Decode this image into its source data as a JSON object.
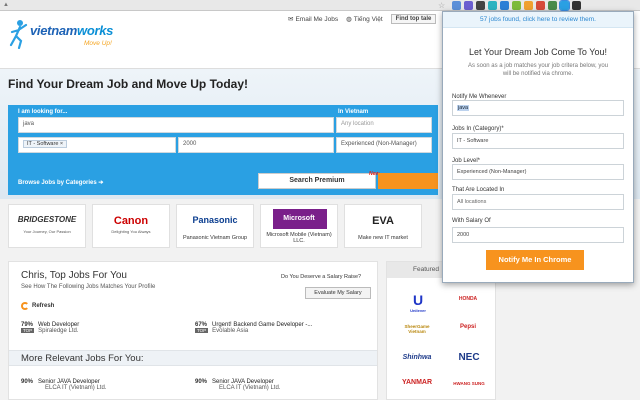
{
  "browser": {
    "extensions": [
      {
        "icon": "folder-icon",
        "color": "#5b8fd8"
      },
      {
        "icon": "extension-icon-2",
        "color": "#6b5ed0"
      },
      {
        "icon": "extension-icon-3",
        "color": "#444444"
      },
      {
        "icon": "extension-icon-4",
        "color": "#2bb3c0"
      },
      {
        "icon": "extension-icon-5",
        "color": "#2d7fd6"
      },
      {
        "icon": "extension-icon-6",
        "color": "#7dbb3a"
      },
      {
        "icon": "extension-icon-7",
        "color": "#f0a030"
      },
      {
        "icon": "extension-icon-8",
        "color": "#d64a3a"
      },
      {
        "icon": "extension-icon-9",
        "color": "#4a8a4a"
      },
      {
        "icon": "vietnamworks-extension-icon",
        "color": "#2aa0e3"
      },
      {
        "icon": "github-icon",
        "color": "#333333"
      }
    ]
  },
  "header": {
    "logo_main": "vietnam",
    "logo_accent": "works",
    "logo_tagline": "Move Up!",
    "email_jobs": "Email Me Jobs",
    "language": "Tiếng Việt",
    "find_top_button": "Find top tale"
  },
  "hero": {
    "title": "Find Your Dream Job and Move Up Today!",
    "looking_for_label": "I am looking for...",
    "keyword_value": "java",
    "location_label": "In Vietnam",
    "location_placeholder": "Any location",
    "category_chip": "IT - Software ×",
    "salary_value": "2000",
    "level_value": "Experienced (Non-Manager)",
    "browse_link": "Browse Jobs by Categories ➔",
    "search_premium": "Search Premium",
    "new_badge": "New"
  },
  "employers": [
    {
      "brand": "BRIDGESTONE",
      "sub": "Your Journey, Our Passion",
      "caption": "",
      "color": "#111111"
    },
    {
      "brand": "Canon",
      "sub": "Delighting You Always",
      "caption": "",
      "color": "#cc0000"
    },
    {
      "brand": "Panasonic",
      "sub": "",
      "caption": "Panasonic Vietnam Group",
      "color": "#0a3d8f"
    },
    {
      "brand": "Microsoft",
      "sub": "",
      "caption": "Microsoft Mobile (Vietnam) LLC.",
      "color": "#ffffff"
    },
    {
      "brand": "EVA",
      "sub": "",
      "caption": "Make new IT market",
      "color": "#222222"
    }
  ],
  "jobs": {
    "title": "Chris, Top Jobs For You",
    "subtitle": "See How The Following Jobs Matches Your Profile",
    "refresh": "Refresh",
    "salary_question": "Do You Deserve a Salary Raise?",
    "salary_button": "Evaluate My Salary",
    "top_jobs": [
      {
        "pct": "79%",
        "title": "Web Developer",
        "tag": "TOP",
        "company": "Spiraledge Ltd."
      },
      {
        "pct": "67%",
        "title": "Urgent! Backend Game Developer -...",
        "tag": "TOP",
        "company": "Evolable Asia"
      }
    ],
    "more_title": "More Relevant Jobs For You:",
    "more_jobs": [
      {
        "pct": "90%",
        "title": "Senior JAVA Developer",
        "company": "ELCA IT (Vietnam) Ltd."
      },
      {
        "pct": "90%",
        "title": "Senior JAVA Developer",
        "company": "ELCA IT (Vietnam) Ltd."
      }
    ]
  },
  "featured": {
    "title": "Featured",
    "logos": [
      {
        "name": "Unilever",
        "color": "#1f36c7"
      },
      {
        "name": "HONDA",
        "color": "#cc2222"
      },
      {
        "name": "SheerGame Vietnam",
        "color": "#b8860b"
      },
      {
        "name": "Pepsi",
        "color": "#cc2222"
      },
      {
        "name": "Shinhwa",
        "color": "#1d3a8a"
      },
      {
        "name": "NEC",
        "color": "#1d3a8a"
      },
      {
        "name": "YANMAR",
        "color": "#cc2222"
      },
      {
        "name": "HWANG SUNG",
        "color": "#cc2222"
      }
    ]
  },
  "popup": {
    "found_text": "57 jobs found, click here to review them.",
    "title": "Let Your Dream Job Come To You!",
    "description": "As soon as a job matches your job critera below, you will be notified via chrome.",
    "notify_label": "Notify Me Whenever",
    "notify_value": "java",
    "category_label": "Jobs In (Category)*",
    "category_value": "IT - Software",
    "level_label": "Job Level*",
    "level_value": "Experienced (Non-Manager)",
    "location_label": "That Are Located In",
    "location_value": "All locations",
    "salary_label": "With Salary Of",
    "salary_value": "2000",
    "notify_button": "Notify Me In Chrome"
  }
}
